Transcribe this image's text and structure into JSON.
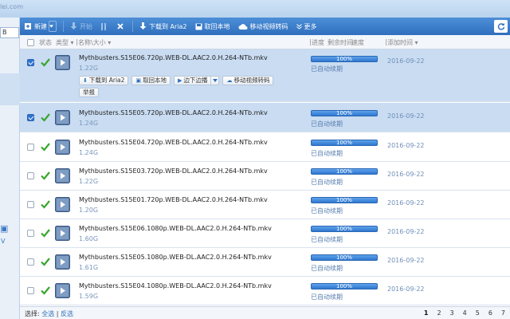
{
  "app": {
    "logo_text": "lei.com",
    "left_box_text": "B",
    "left_v_text": "V"
  },
  "toolbar": {
    "new_label": "新建",
    "start_label": "开始",
    "download_aria2_label": "下载到 Aria2",
    "fetch_local_label": "取回本地",
    "mobile_transcode_label": "移动视频转码",
    "more_label": "更多"
  },
  "header": {
    "status": "状态",
    "type": "类型",
    "name_size": "名称\\大小",
    "progress": "进度",
    "remaining": "剩余时间",
    "speed": "速度",
    "added_time": "添加时间"
  },
  "row_actions": {
    "download_aria2": "下载到 Aria2",
    "fetch_local": "取回本地",
    "stream_play": "边下边播",
    "mobile_transcode": "移动视频转码",
    "report": "举报"
  },
  "rows": [
    {
      "name": "Mythbusters.S15E06.720p.WEB-DL.AAC2.0.H.264-NTb.mkv",
      "size": "1.22G",
      "progress": "100%",
      "status": "已自动续期",
      "date": "2016-09-22",
      "checked": true
    },
    {
      "name": "Mythbusters.S15E05.720p.WEB-DL.AAC2.0.H.264-NTb.mkv",
      "size": "1.24G",
      "progress": "100%",
      "status": "已自动续期",
      "date": "2016-09-22",
      "checked": true
    },
    {
      "name": "Mythbusters.S15E04.720p.WEB-DL.AAC2.0.H.264-NTb.mkv",
      "size": "1.24G",
      "progress": "100%",
      "status": "已自动续期",
      "date": "2016-09-22",
      "checked": false
    },
    {
      "name": "Mythbusters.S15E03.720p.WEB-DL.AAC2.0.H.264-NTb.mkv",
      "size": "1.22G",
      "progress": "100%",
      "status": "已自动续期",
      "date": "2016-09-22",
      "checked": false
    },
    {
      "name": "Mythbusters.S15E01.720p.WEB-DL.AAC2.0.H.264-NTb.mkv",
      "size": "1.20G",
      "progress": "100%",
      "status": "已自动续期",
      "date": "2016-09-22",
      "checked": false
    },
    {
      "name": "Mythbusters.S15E06.1080p.WEB-DL.AAC2.0.H.264-NTb.mkv",
      "size": "1.60G",
      "progress": "100%",
      "status": "已自动续期",
      "date": "2016-09-22",
      "checked": false
    },
    {
      "name": "Mythbusters.S15E05.1080p.WEB-DL.AAC2.0.H.264-NTb.mkv",
      "size": "1.61G",
      "progress": "100%",
      "status": "已自动续期",
      "date": "2016-09-22",
      "checked": false
    },
    {
      "name": "Mythbusters.S15E04.1080p.WEB-DL.AAC2.0.H.264-NTb.mkv",
      "size": "1.59G",
      "progress": "100%",
      "status": "已自动续期",
      "date": "2016-09-22",
      "checked": false
    }
  ],
  "footer": {
    "select_label": "选择:",
    "select_all": "全选",
    "divider": "|",
    "invert": "反选",
    "pages": [
      "1",
      "2",
      "3",
      "4",
      "5",
      "6",
      "7"
    ],
    "current_page": "1"
  }
}
